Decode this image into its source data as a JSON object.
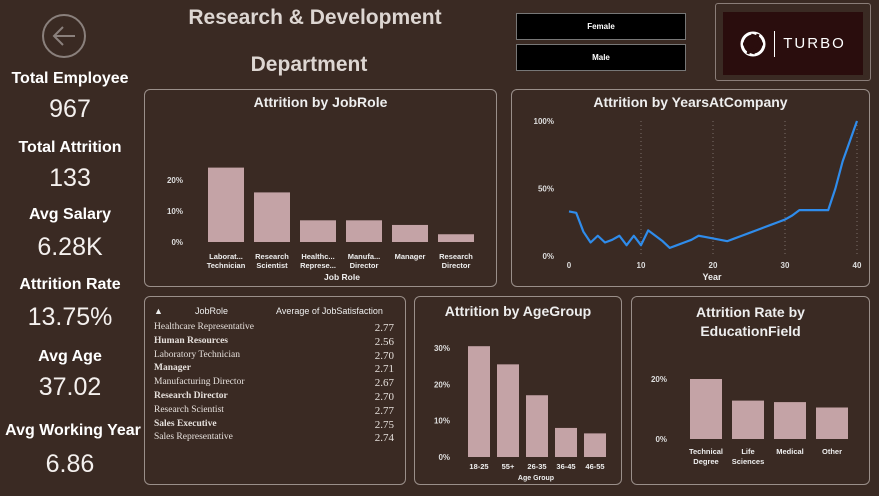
{
  "header": {
    "title_line1": "Research & Development",
    "title_line2": "Department"
  },
  "slicers": [
    "Female",
    "Male"
  ],
  "logo": {
    "text": "TURBO"
  },
  "kpis": [
    {
      "label": "Total Employee",
      "value": "967"
    },
    {
      "label": "Total Attrition",
      "value": "133"
    },
    {
      "label": "Avg Salary",
      "value": "6.28K"
    },
    {
      "label": "Attrition Rate",
      "value": "13.75%"
    },
    {
      "label": "Avg Age",
      "value": "37.02"
    },
    {
      "label": "Avg Working Year",
      "value": "6.86"
    }
  ],
  "table": {
    "col1": "JobRole",
    "col2": "Average of JobSatisfaction",
    "rows": [
      {
        "role": "Healthcare Representative",
        "value": "2.77"
      },
      {
        "role": "Human Resources",
        "value": "2.56"
      },
      {
        "role": "Laboratory Technician",
        "value": "2.70"
      },
      {
        "role": "Manager",
        "value": "2.71"
      },
      {
        "role": "Manufacturing Director",
        "value": "2.67"
      },
      {
        "role": "Research Director",
        "value": "2.70"
      },
      {
        "role": "Research Scientist",
        "value": "2.77"
      },
      {
        "role": "Sales Executive",
        "value": "2.75"
      },
      {
        "role": "Sales Representative",
        "value": "2.74"
      }
    ]
  },
  "colors": {
    "bar": "#c4a3a6",
    "line": "#2f8ceb",
    "background": "#3a2a23"
  },
  "chart_data": [
    {
      "type": "bar",
      "title": "Attrition by JobRole",
      "xlabel": "Job Role",
      "ylabel": "",
      "categories": [
        "Laborat... Technician",
        "Research Scientist",
        "Healthc... Represe...",
        "Manufa... Director",
        "Manager",
        "Research Director"
      ],
      "values": [
        24,
        16,
        7,
        7,
        5.5,
        2.5
      ],
      "ylim": [
        0,
        26
      ],
      "yticks": [
        "0%",
        "10%",
        "20%"
      ],
      "grid": false
    },
    {
      "type": "line",
      "title": "Attrition by YearsAtCompany",
      "xlabel": "Year",
      "ylabel": "",
      "x": [
        0,
        1,
        2,
        3,
        4,
        5,
        6,
        7,
        8,
        9,
        10,
        11,
        12,
        13,
        14,
        15,
        16,
        17,
        18,
        19,
        20,
        21,
        22,
        23,
        24,
        25,
        26,
        27,
        28,
        29,
        30,
        31,
        32,
        33,
        34,
        35,
        36,
        37,
        38,
        39,
        40
      ],
      "values": [
        33,
        32,
        18,
        10,
        15,
        10,
        12,
        15,
        8,
        15,
        8,
        19,
        15,
        11,
        6,
        8,
        10,
        12,
        15,
        14,
        13,
        12,
        11,
        13,
        15,
        17,
        19,
        21,
        23,
        25,
        27,
        30,
        34,
        34,
        34,
        34,
        34,
        50,
        70,
        85,
        100
      ],
      "ylim": [
        0,
        100
      ],
      "xticks": [
        "0",
        "10",
        "20",
        "30",
        "40"
      ],
      "yticks": [
        "0%",
        "50%",
        "100%"
      ],
      "grid": true
    },
    {
      "type": "bar",
      "title": "Attrition by AgeGroup",
      "xlabel": "Age Group",
      "ylabel": "",
      "categories": [
        "18-25",
        "55+",
        "26-35",
        "36-45",
        "46-55"
      ],
      "values": [
        30.5,
        25.5,
        17,
        8,
        6.5
      ],
      "ylim": [
        0,
        33
      ],
      "yticks": [
        "0%",
        "10%",
        "20%",
        "30%"
      ],
      "grid": false
    },
    {
      "type": "bar",
      "title": "Attrition Rate by EducationField",
      "xlabel": "",
      "ylabel": "",
      "categories": [
        "Technical Degree",
        "Life Sciences",
        "Medical",
        "Other"
      ],
      "values": [
        20,
        12.8,
        12.3,
        10.5
      ],
      "ylim": [
        0,
        24
      ],
      "yticks": [
        "0%",
        "20%"
      ],
      "grid": false
    }
  ]
}
